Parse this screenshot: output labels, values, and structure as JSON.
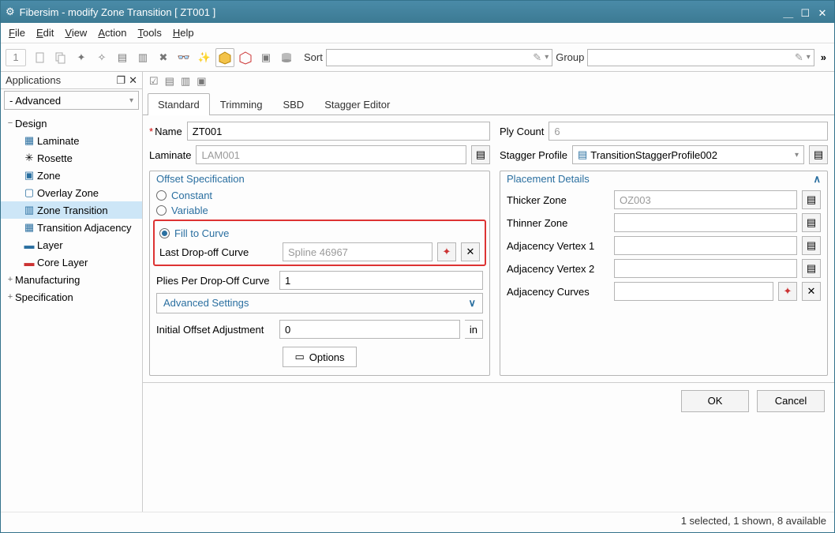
{
  "window": {
    "title": "Fibersim - modify Zone Transition [ ZT001 ]"
  },
  "menu": {
    "file": "File",
    "edit": "Edit",
    "view": "View",
    "action": "Action",
    "tools": "Tools",
    "help": "Help"
  },
  "toolbar": {
    "page": "1",
    "sort_label": "Sort",
    "group_label": "Group",
    "more": "»"
  },
  "apps": {
    "title": "Applications",
    "combo": "- Advanced"
  },
  "tree": {
    "design": "Design",
    "laminate": "Laminate",
    "rosette": "Rosette",
    "zone": "Zone",
    "overlay": "Overlay Zone",
    "zt": "Zone Transition",
    "ta": "Transition Adjacency",
    "layer": "Layer",
    "core": "Core Layer",
    "mfg": "Manufacturing",
    "spec": "Specification"
  },
  "tabs": {
    "std": "Standard",
    "trim": "Trimming",
    "sbd": "SBD",
    "stg": "Stagger Editor"
  },
  "fields": {
    "name_lbl": "Name",
    "name_val": "ZT001",
    "plycount_lbl": "Ply Count",
    "plycount_val": "6",
    "lam_lbl": "Laminate",
    "lam_val": "LAM001",
    "sp_lbl": "Stagger Profile",
    "sp_val": "TransitionStaggerProfile002",
    "os_hdr": "Offset Specification",
    "r_const": "Constant",
    "r_var": "Variable",
    "r_ftc": "Fill to Curve",
    "ldc_lbl": "Last Drop-off Curve",
    "ldc_val": "Spline 46967",
    "ppd_lbl": "Plies Per Drop-Off Curve",
    "ppd_val": "1",
    "adv": "Advanced Settings",
    "ioa_lbl": "Initial Offset Adjustment",
    "ioa_val": "0",
    "ioa_unit": "in",
    "opt": "Options",
    "pd_hdr": "Placement Details",
    "thicker": "Thicker Zone",
    "thicker_val": "OZ003",
    "thinner": "Thinner Zone",
    "av1": "Adjacency Vertex 1",
    "av2": "Adjacency Vertex 2",
    "ac": "Adjacency Curves"
  },
  "footer": {
    "ok": "OK",
    "cancel": "Cancel"
  },
  "status": "1 selected, 1 shown, 8 available"
}
